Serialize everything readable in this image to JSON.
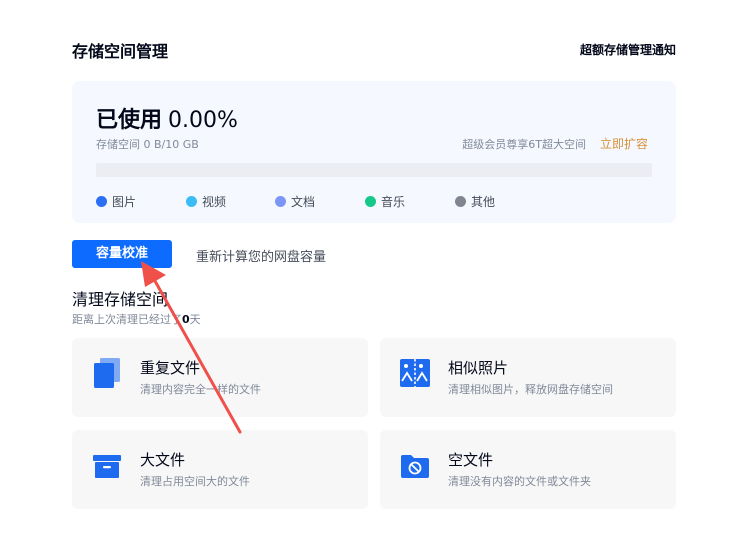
{
  "header": {
    "title": "存储空间管理",
    "notice_link": "超额存储管理通知"
  },
  "usage": {
    "used_label": "已使用",
    "percent": "0.00%",
    "percent_value": 0.0,
    "detail": "存储空间 0 B/10 GB",
    "vip_text": "超级会员尊享6T超大空间",
    "expand_label": "立即扩容",
    "legend": [
      {
        "label": "图片",
        "color": "#2a6ff5"
      },
      {
        "label": "视频",
        "color": "#3bbcf5"
      },
      {
        "label": "文档",
        "color": "#7b96f7"
      },
      {
        "label": "音乐",
        "color": "#16c889"
      },
      {
        "label": "其他",
        "color": "#808590"
      }
    ]
  },
  "calibrate": {
    "button": "容量校准",
    "description": "重新计算您的网盘容量"
  },
  "clean": {
    "title": "清理存储空间",
    "subtitle_prefix": "距离上次清理已经过了",
    "days": "0",
    "subtitle_suffix": "天",
    "tools": [
      {
        "title": "重复文件",
        "desc": "清理内容完全一样的文件",
        "icon": "duplicate-files-icon"
      },
      {
        "title": "相似照片",
        "desc": "清理相似图片，释放网盘存储空间",
        "icon": "similar-photos-icon"
      },
      {
        "title": "大文件",
        "desc": "清理占用空间大的文件",
        "icon": "large-file-box-icon"
      },
      {
        "title": "空文件",
        "desc": "清理没有内容的文件或文件夹",
        "icon": "empty-folder-icon"
      }
    ]
  },
  "colors": {
    "accent": "#0d6bff",
    "expand": "#d5923b",
    "annotation": "#f0504a"
  }
}
